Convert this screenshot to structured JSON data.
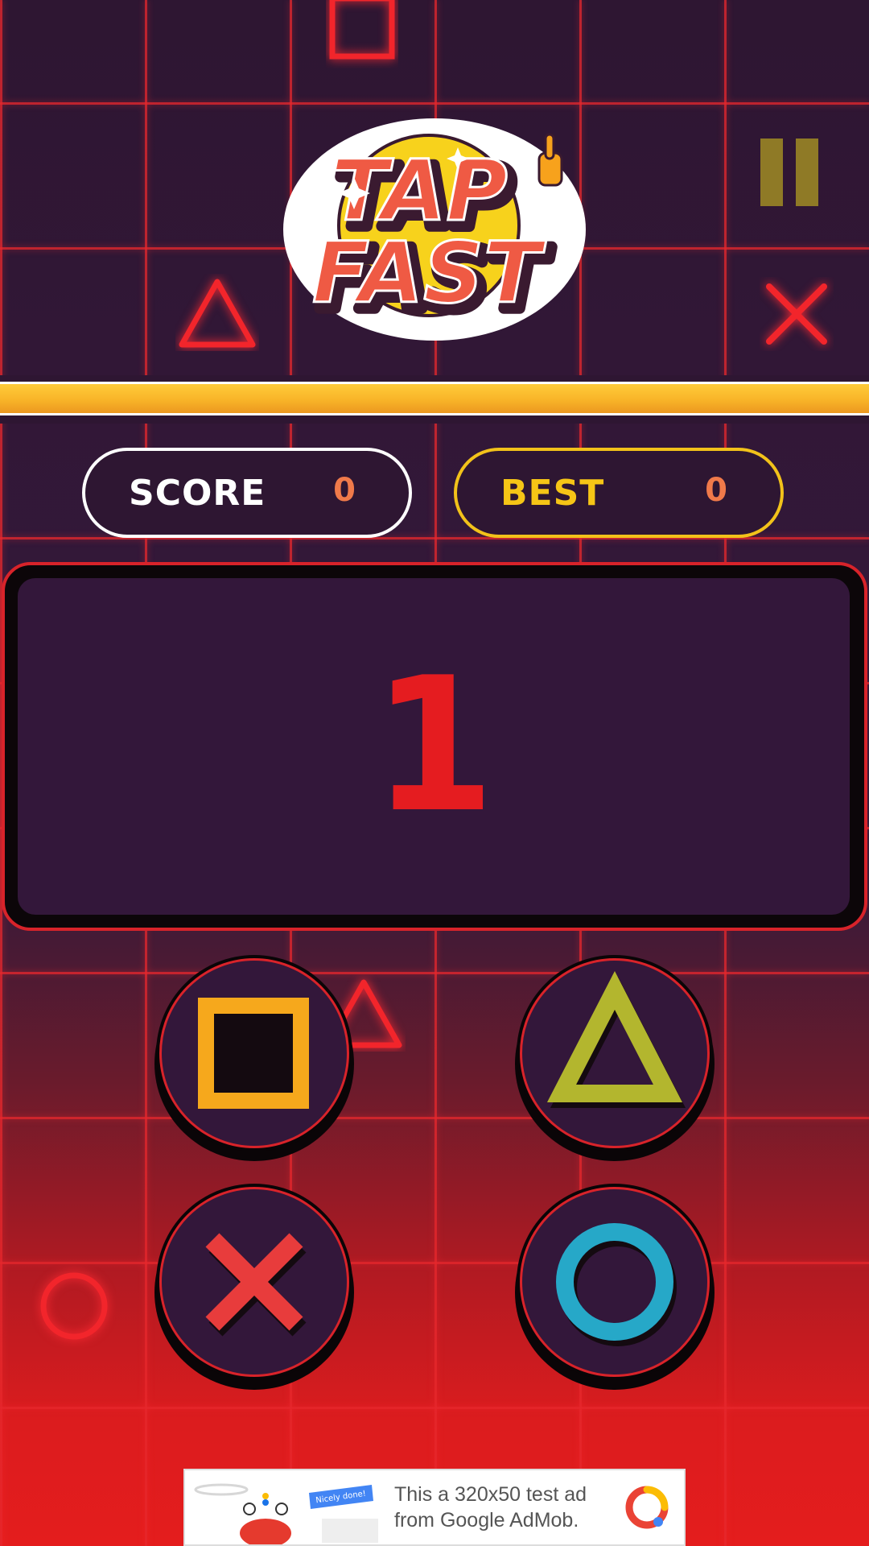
{
  "app": {
    "logo_line1": "TAP",
    "logo_line2": "FAST"
  },
  "scoreboard": {
    "score_label": "SCORE",
    "score_value": "0",
    "best_label": "BEST",
    "best_value": "0"
  },
  "display": {
    "current_number": "1"
  },
  "buttons": [
    {
      "name": "square",
      "icon": "square-icon",
      "color": "#f6a81c"
    },
    {
      "name": "triangle",
      "icon": "triangle-icon",
      "color": "#b3b62e"
    },
    {
      "name": "cross",
      "icon": "cross-icon",
      "color": "#e83c3c"
    },
    {
      "name": "circle",
      "icon": "circle-icon",
      "color": "#26a8c8"
    }
  ],
  "ad": {
    "line1": "This a 320x50 test ad",
    "line2": "from Google AdMob.",
    "banner_tag": "Nicely done!"
  },
  "colors": {
    "background_top": "#2e1632",
    "background_bottom": "#e41d1d",
    "grid_line": "#e6282d",
    "accent_gold": "#f6c516",
    "score_value": "#f07a4a",
    "number": "#e51c20"
  }
}
